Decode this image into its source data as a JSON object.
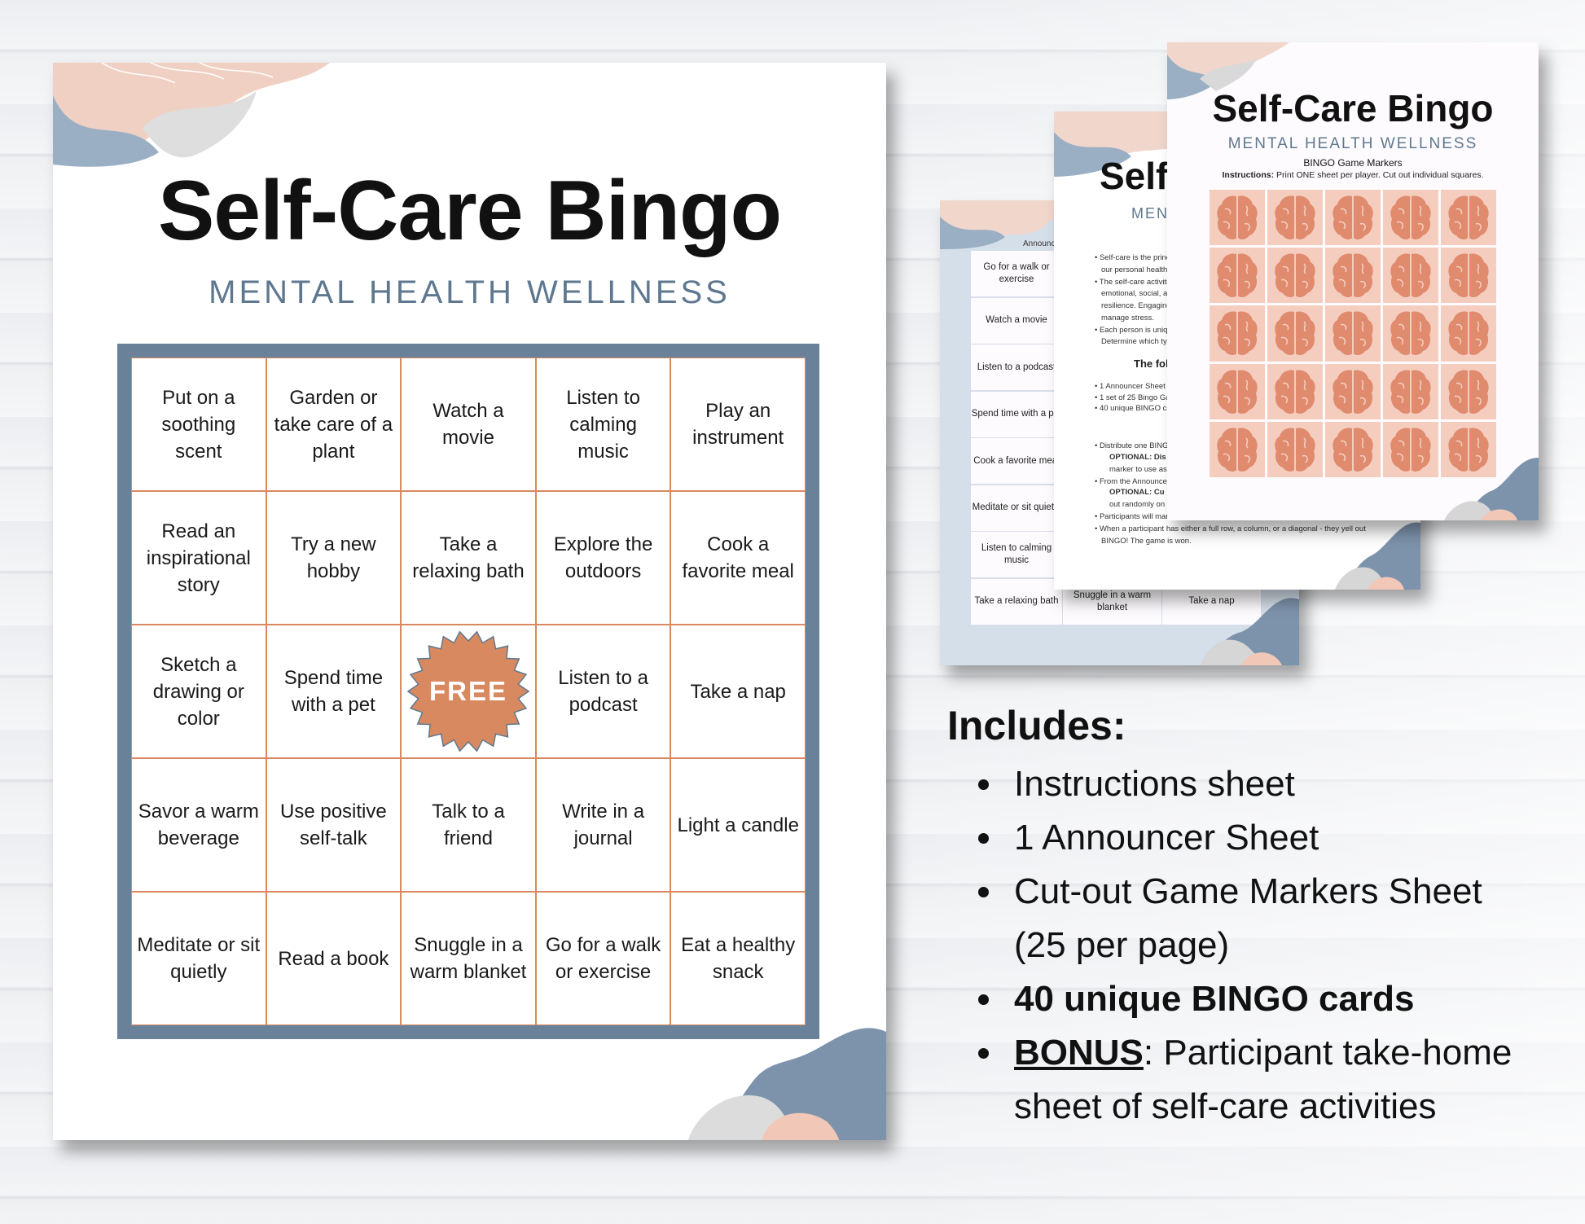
{
  "main_sheet": {
    "title": "Self-Care Bingo",
    "subtitle": "MENTAL HEALTH WELLNESS",
    "cells": [
      "Put on a soothing scent",
      "Garden or take care of a plant",
      "Watch a movie",
      "Listen to calming music",
      "Play an instrument",
      "Read an inspirational story",
      "Try a new hobby",
      "Take a relaxing bath",
      "Explore the outdoors",
      "Cook a favorite meal",
      "Sketch a drawing or color",
      "Spend time with a pet",
      "FREE",
      "Listen to a podcast",
      "Take a nap",
      "Savor a warm beverage",
      "Use positive self-talk",
      "Talk to a friend",
      "Write in a journal",
      "Light a candle",
      "Meditate or sit quietly",
      "Read a book",
      "Snuggle in a warm blanket",
      "Go for a walk or exercise",
      "Eat a healthy snack"
    ],
    "free_label": "FREE"
  },
  "announcer_sheet": {
    "header": "Announc",
    "rows": [
      "Go for a walk or exercise",
      "Watch a movie",
      "Listen to a podcast",
      "Spend time with a pet",
      "Cook a favorite meal",
      "Meditate or sit quietly",
      "Listen to calming music",
      "Take a relaxing bath"
    ],
    "bottom_row_extra": [
      "Snuggle in a warm blanket",
      "Take a nap"
    ]
  },
  "instructions_sheet": {
    "title": "Self",
    "subtitle": "MENT",
    "lines": [
      "• Self-care is the princ",
      "our personal health a",
      "• The self-care activiti",
      "emotional, social, an",
      "resilience. Engaging",
      "manage stress.",
      "• Each person is uniqu",
      "Determine which typ"
    ],
    "heading": "The fol",
    "list": [
      "• 1 Announcer Sheet o",
      "• 1 set of 25 Bingo Ga",
      "• 40 unique BINGO ca"
    ],
    "steps": [
      "• Distribute one BINGO",
      "OPTIONAL: Dis",
      "marker to use as",
      "• From the Announcer",
      "OPTIONAL: Cu",
      "out randomly on",
      "• Participants will mar",
      "• When a participant has either a full row, a column, or a diagonal - they yell out",
      "BINGO! The game is won."
    ]
  },
  "markers_sheet": {
    "title": "Self-Care Bingo",
    "subtitle": "MENTAL HEALTH WELLNESS",
    "heading": "BINGO Game Markers",
    "instructions_label": "Instructions:",
    "instructions": " Print ONE sheet per player. Cut out individual squares.",
    "marker_icon": "brain-icon",
    "marker_count": 25
  },
  "includes": {
    "heading": "Includes:",
    "items": [
      "Instructions sheet",
      "1 Announcer Sheet",
      "Cut-out Game Markers Sheet",
      "(25 per page)",
      "40 unique BINGO cards"
    ],
    "bonus_label": "BONUS",
    "bonus_text": ": Participant take-home",
    "bonus_text_2": "sheet of self-care activities"
  },
  "colors": {
    "slate": "#6a819a",
    "orange": "#d9895f",
    "peach": "#f4cdbf",
    "marker_brain": "#e08a6e",
    "light_blue": "#d5dfe9"
  }
}
